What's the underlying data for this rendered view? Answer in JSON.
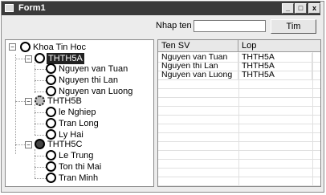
{
  "window": {
    "title": "Form1",
    "min": "_",
    "max": "□",
    "close": "x"
  },
  "search": {
    "label": "Nhap ten",
    "value": "",
    "button": "Tim"
  },
  "tree": {
    "root": "Khoa Tin Hoc",
    "classes": [
      {
        "name": "THTH5A",
        "icon": "circle-icon",
        "selected": true,
        "students": [
          "Nguyen van Tuan",
          "Nguyen thi Lan",
          "Nguyen van Luong"
        ]
      },
      {
        "name": "THTH5B",
        "icon": "flower-icon",
        "selected": false,
        "students": [
          "le Nghiep",
          "Tran Long",
          "Ly Hai"
        ]
      },
      {
        "name": "THTH5C",
        "icon": "globe-icon",
        "selected": false,
        "students": [
          "Le Trung",
          "Ton thi Mai",
          "Tran Minh"
        ]
      }
    ]
  },
  "grid": {
    "columns": [
      "Ten SV",
      "Lop"
    ],
    "rows": [
      [
        "Nguyen van Tuan",
        "THTH5A"
      ],
      [
        "Nguyen thi Lan",
        "THTH5A"
      ],
      [
        "Nguyen van Luong",
        "THTH5A"
      ]
    ]
  }
}
